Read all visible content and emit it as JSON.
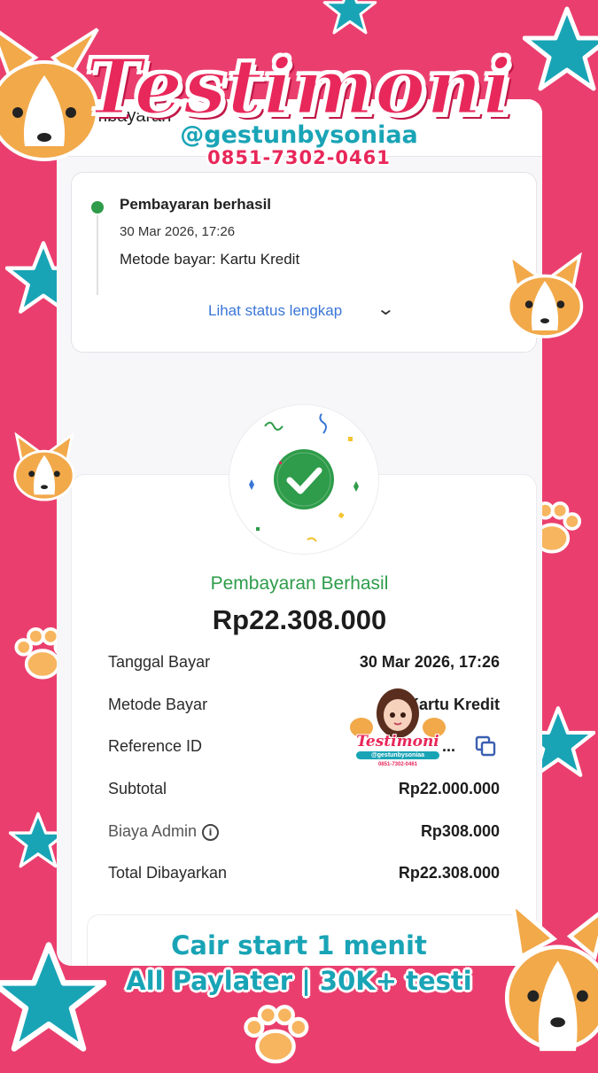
{
  "screen": {
    "header_title": "Pembayaran"
  },
  "status_card": {
    "title": "Pembayaran berhasil",
    "time": "30 Mar 2026, 17:26",
    "method": "Metode bayar: Kartu Kredit",
    "link": "Lihat status lengkap"
  },
  "success": {
    "label": "Pembayaran Berhasil",
    "amount": "Rp22.308.000"
  },
  "details": {
    "rows": [
      {
        "label": "Tanggal Bayar",
        "value": "30 Mar 2026, 17:26"
      },
      {
        "label": "Metode Bayar",
        "value": "Kartu Kredit"
      },
      {
        "label": "Reference ID",
        "value": "..."
      },
      {
        "label": "Subtotal",
        "value": "Rp22.000.000"
      },
      {
        "label": "Biaya Admin",
        "value": "Rp308.000"
      },
      {
        "label": "Total Dibayarkan",
        "value": "Rp22.308.000"
      }
    ]
  },
  "branding": {
    "title": "Testimoni",
    "handle": "@gestunbysoniaa",
    "phone": "0851-7302-0461",
    "promo_line1": "Cair start 1 menit",
    "promo_line2": "All Paylater | 30K+ testi"
  },
  "badge": {
    "title": "Testimoni",
    "handle": "@gestunbysoniaa",
    "phone": "0851-7302-0461"
  },
  "colors": {
    "background": "#ea3f6e",
    "accent_teal": "#19a4b6",
    "success_green": "#2e9c4a",
    "link_blue": "#3a76d6",
    "brand_pink": "#e8285a"
  },
  "icons": [
    "check-circle-icon",
    "chevron-down-icon",
    "info-icon",
    "copy-icon",
    "star-icon",
    "paw-icon",
    "corgi-icon"
  ]
}
